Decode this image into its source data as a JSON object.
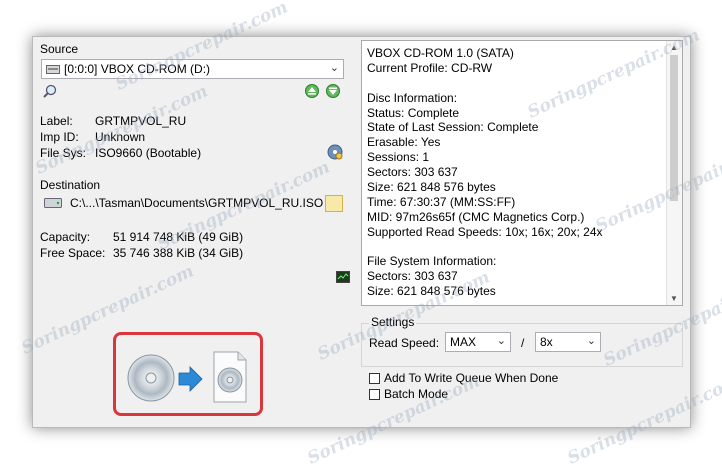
{
  "source": {
    "title": "Source",
    "selected_drive": "[0:0:0] VBOX CD-ROM (D:)",
    "label_key": "Label:",
    "label_val": "GRTMPVOL_RU",
    "impid_key": "Imp ID:",
    "impid_val": "Unknown",
    "filesys_key": "File Sys:",
    "filesys_val": "ISO9660 (Bootable)"
  },
  "destination": {
    "title": "Destination",
    "path": "C:\\...\\Tasman\\Documents\\GRTMPVOL_RU.ISO",
    "capacity_key": "Capacity:",
    "capacity_val": "51 914 748 KiB  (49 GiB)",
    "free_key": "Free Space:",
    "free_val": "35 746 388 KiB  (34 GiB)"
  },
  "info_lines": [
    "VBOX CD-ROM 1.0 (SATA)",
    "Current Profile: CD-RW",
    "",
    "Disc Information:",
    "Status: Complete",
    "State of Last Session: Complete",
    "Erasable: Yes",
    "Sessions: 1",
    "Sectors: 303 637",
    "Size: 621 848 576 bytes",
    "Time: 67:30:37 (MM:SS:FF)",
    "MID: 97m26s65f (CMC Magnetics Corp.)",
    "Supported Read Speeds: 10x; 16x; 20x; 24x",
    "",
    "File System Information:",
    "Sectors: 303 637",
    "Size: 621 848 576 bytes"
  ],
  "settings": {
    "title": "Settings",
    "read_speed_label": "Read Speed:",
    "read_speed_value": "MAX",
    "separator": "/",
    "speed2_value": "8x",
    "queue_label": "Add To Write Queue When Done",
    "batch_label": "Batch Mode"
  },
  "watermark": "Soringpcrepair.com",
  "colors": {
    "highlight": "#d9363e",
    "arrow": "#2b8ad8"
  }
}
